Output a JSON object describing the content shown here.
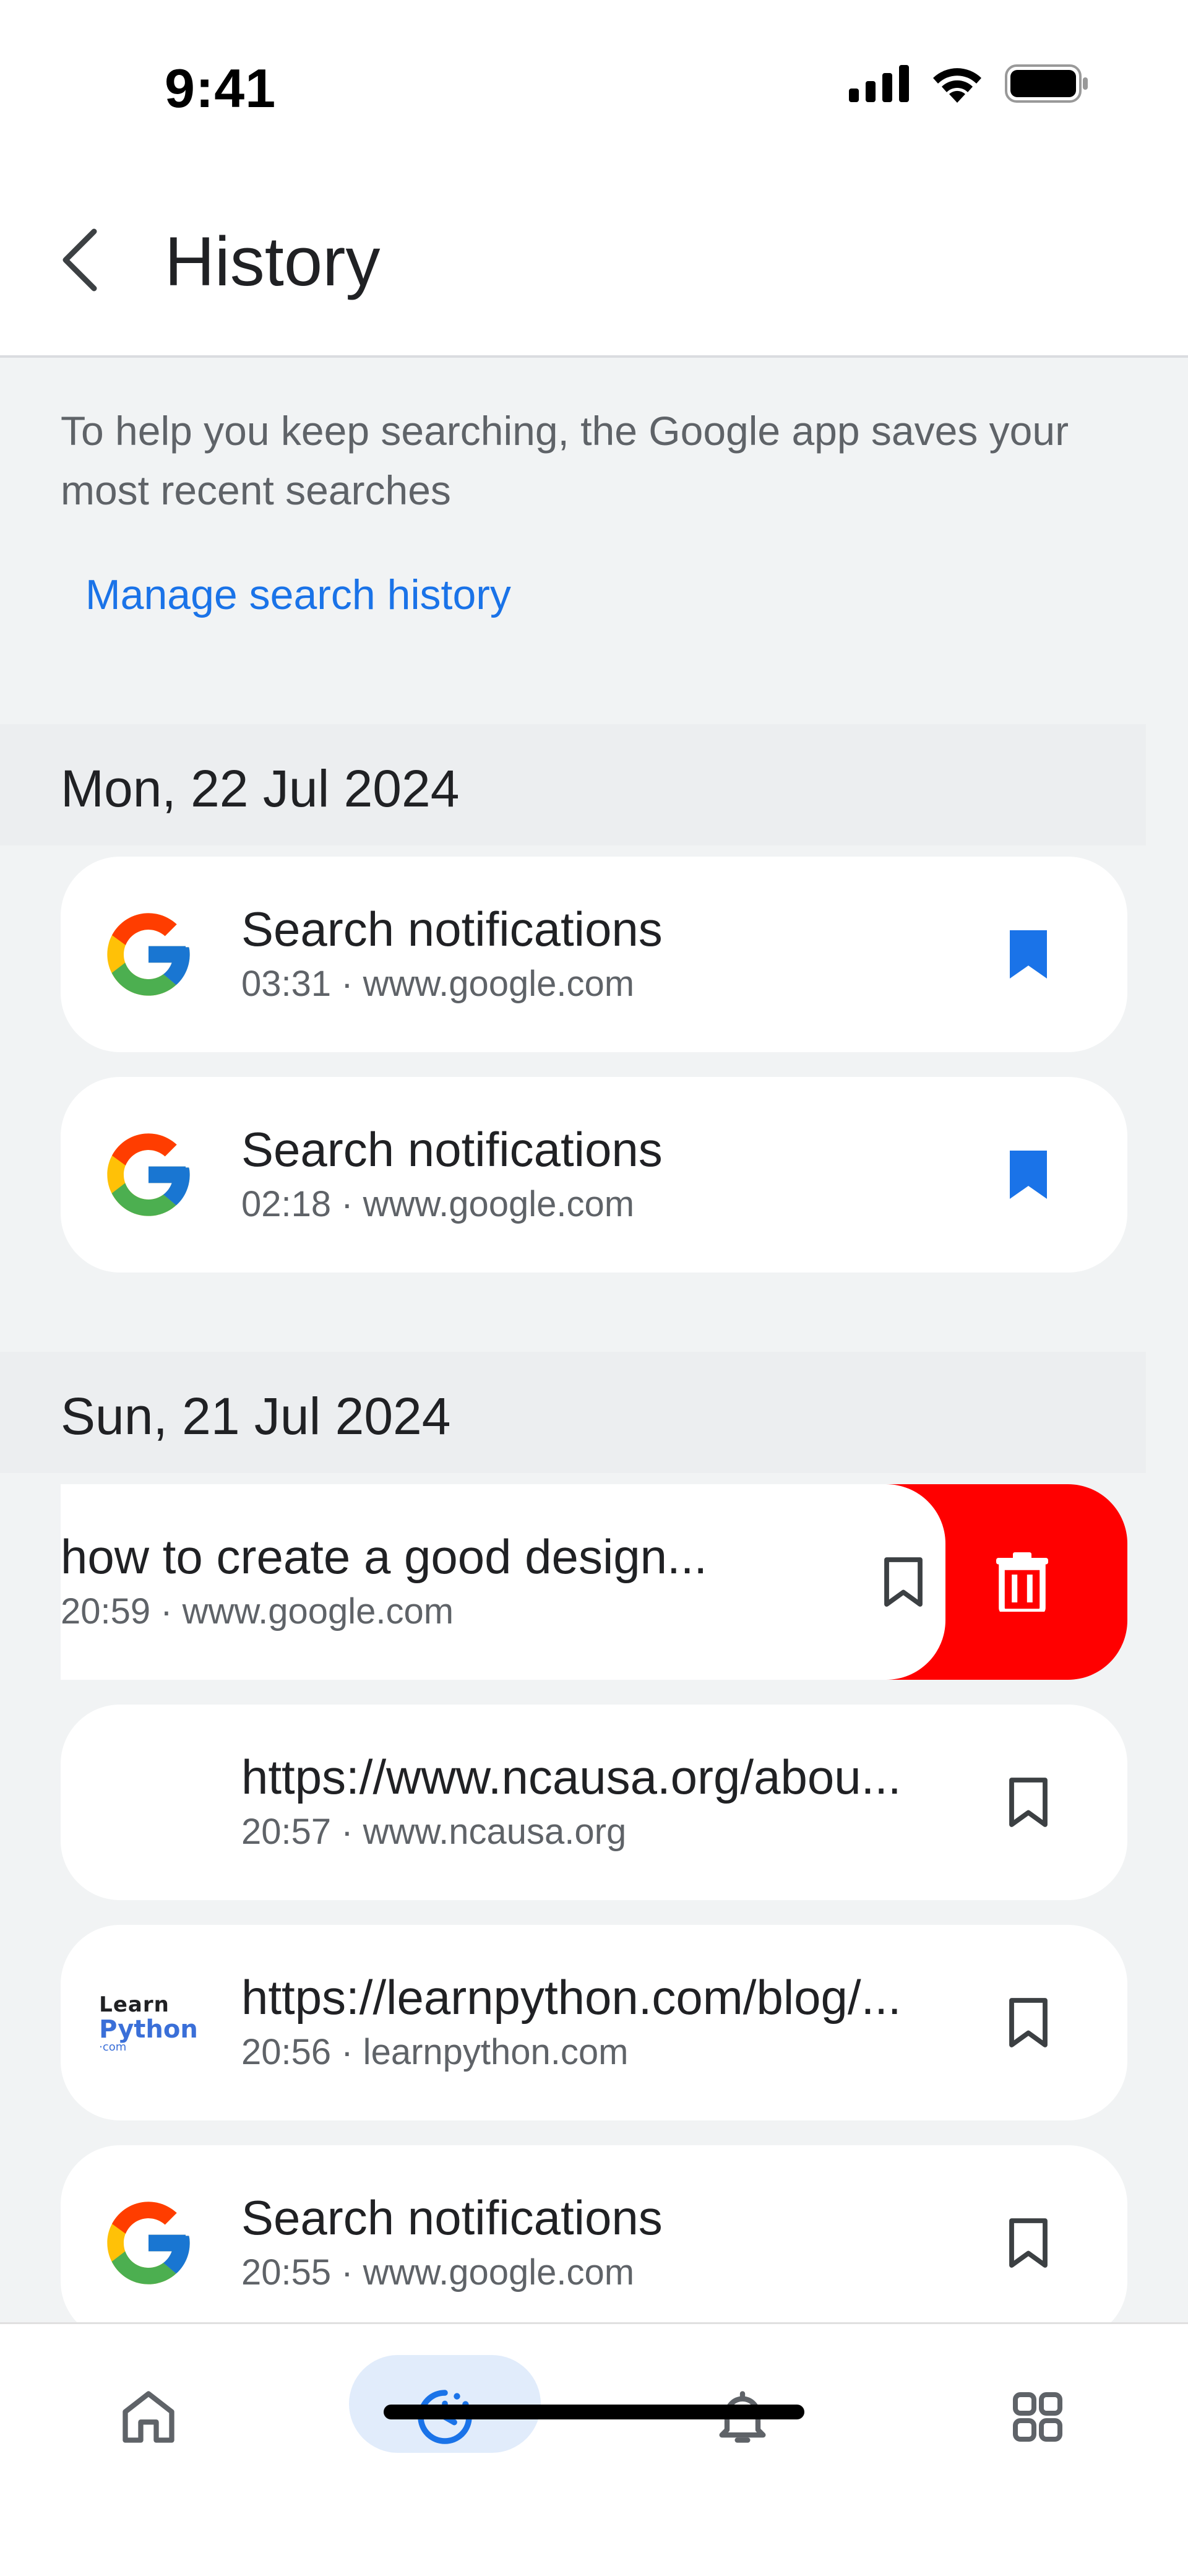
{
  "status_bar": {
    "time": "9:41"
  },
  "header": {
    "title": "History"
  },
  "intro": {
    "text": "To help you keep searching, the Google app saves your most recent searches",
    "manage_link": "Manage search history"
  },
  "sections": [
    {
      "date": "Mon, 22 Jul 2024",
      "items": [
        {
          "title": "Search notifications",
          "meta": "03:31 · www.google.com",
          "favicon": "google-icon",
          "bookmarked": true
        },
        {
          "title": "Search notifications",
          "meta": "02:18 · www.google.com",
          "favicon": "google-icon",
          "bookmarked": true
        }
      ]
    },
    {
      "date": "Sun, 21 Jul 2024",
      "items": [
        {
          "title": "how to create a good design...",
          "meta": "20:59 · www.google.com",
          "favicon": "none",
          "bookmarked": false,
          "swiped": true
        },
        {
          "title": "https://www.ncausa.org/abou...",
          "meta": "20:57 · www.ncausa.org",
          "favicon": "none",
          "bookmarked": false
        },
        {
          "title": "https://learnpython.com/blog/...",
          "meta": "20:56 · learnpython.com",
          "favicon": "learnpython-logo",
          "bookmarked": false
        },
        {
          "title": "Search notifications",
          "meta": "20:55 · www.google.com",
          "favicon": "google-icon",
          "bookmarked": false
        }
      ]
    }
  ],
  "learnpython_logo": {
    "line1": "Learn",
    "line2": "Python",
    "line3": "·com"
  },
  "colors": {
    "accent": "#1a73e8",
    "delete": "#ff0000",
    "background": "#f1f3f4"
  },
  "bottom_nav": {
    "items": [
      {
        "icon": "home-icon",
        "active": false
      },
      {
        "icon": "history-icon",
        "active": true
      },
      {
        "icon": "bell-icon",
        "active": false
      },
      {
        "icon": "grid-icon",
        "active": false
      }
    ]
  }
}
